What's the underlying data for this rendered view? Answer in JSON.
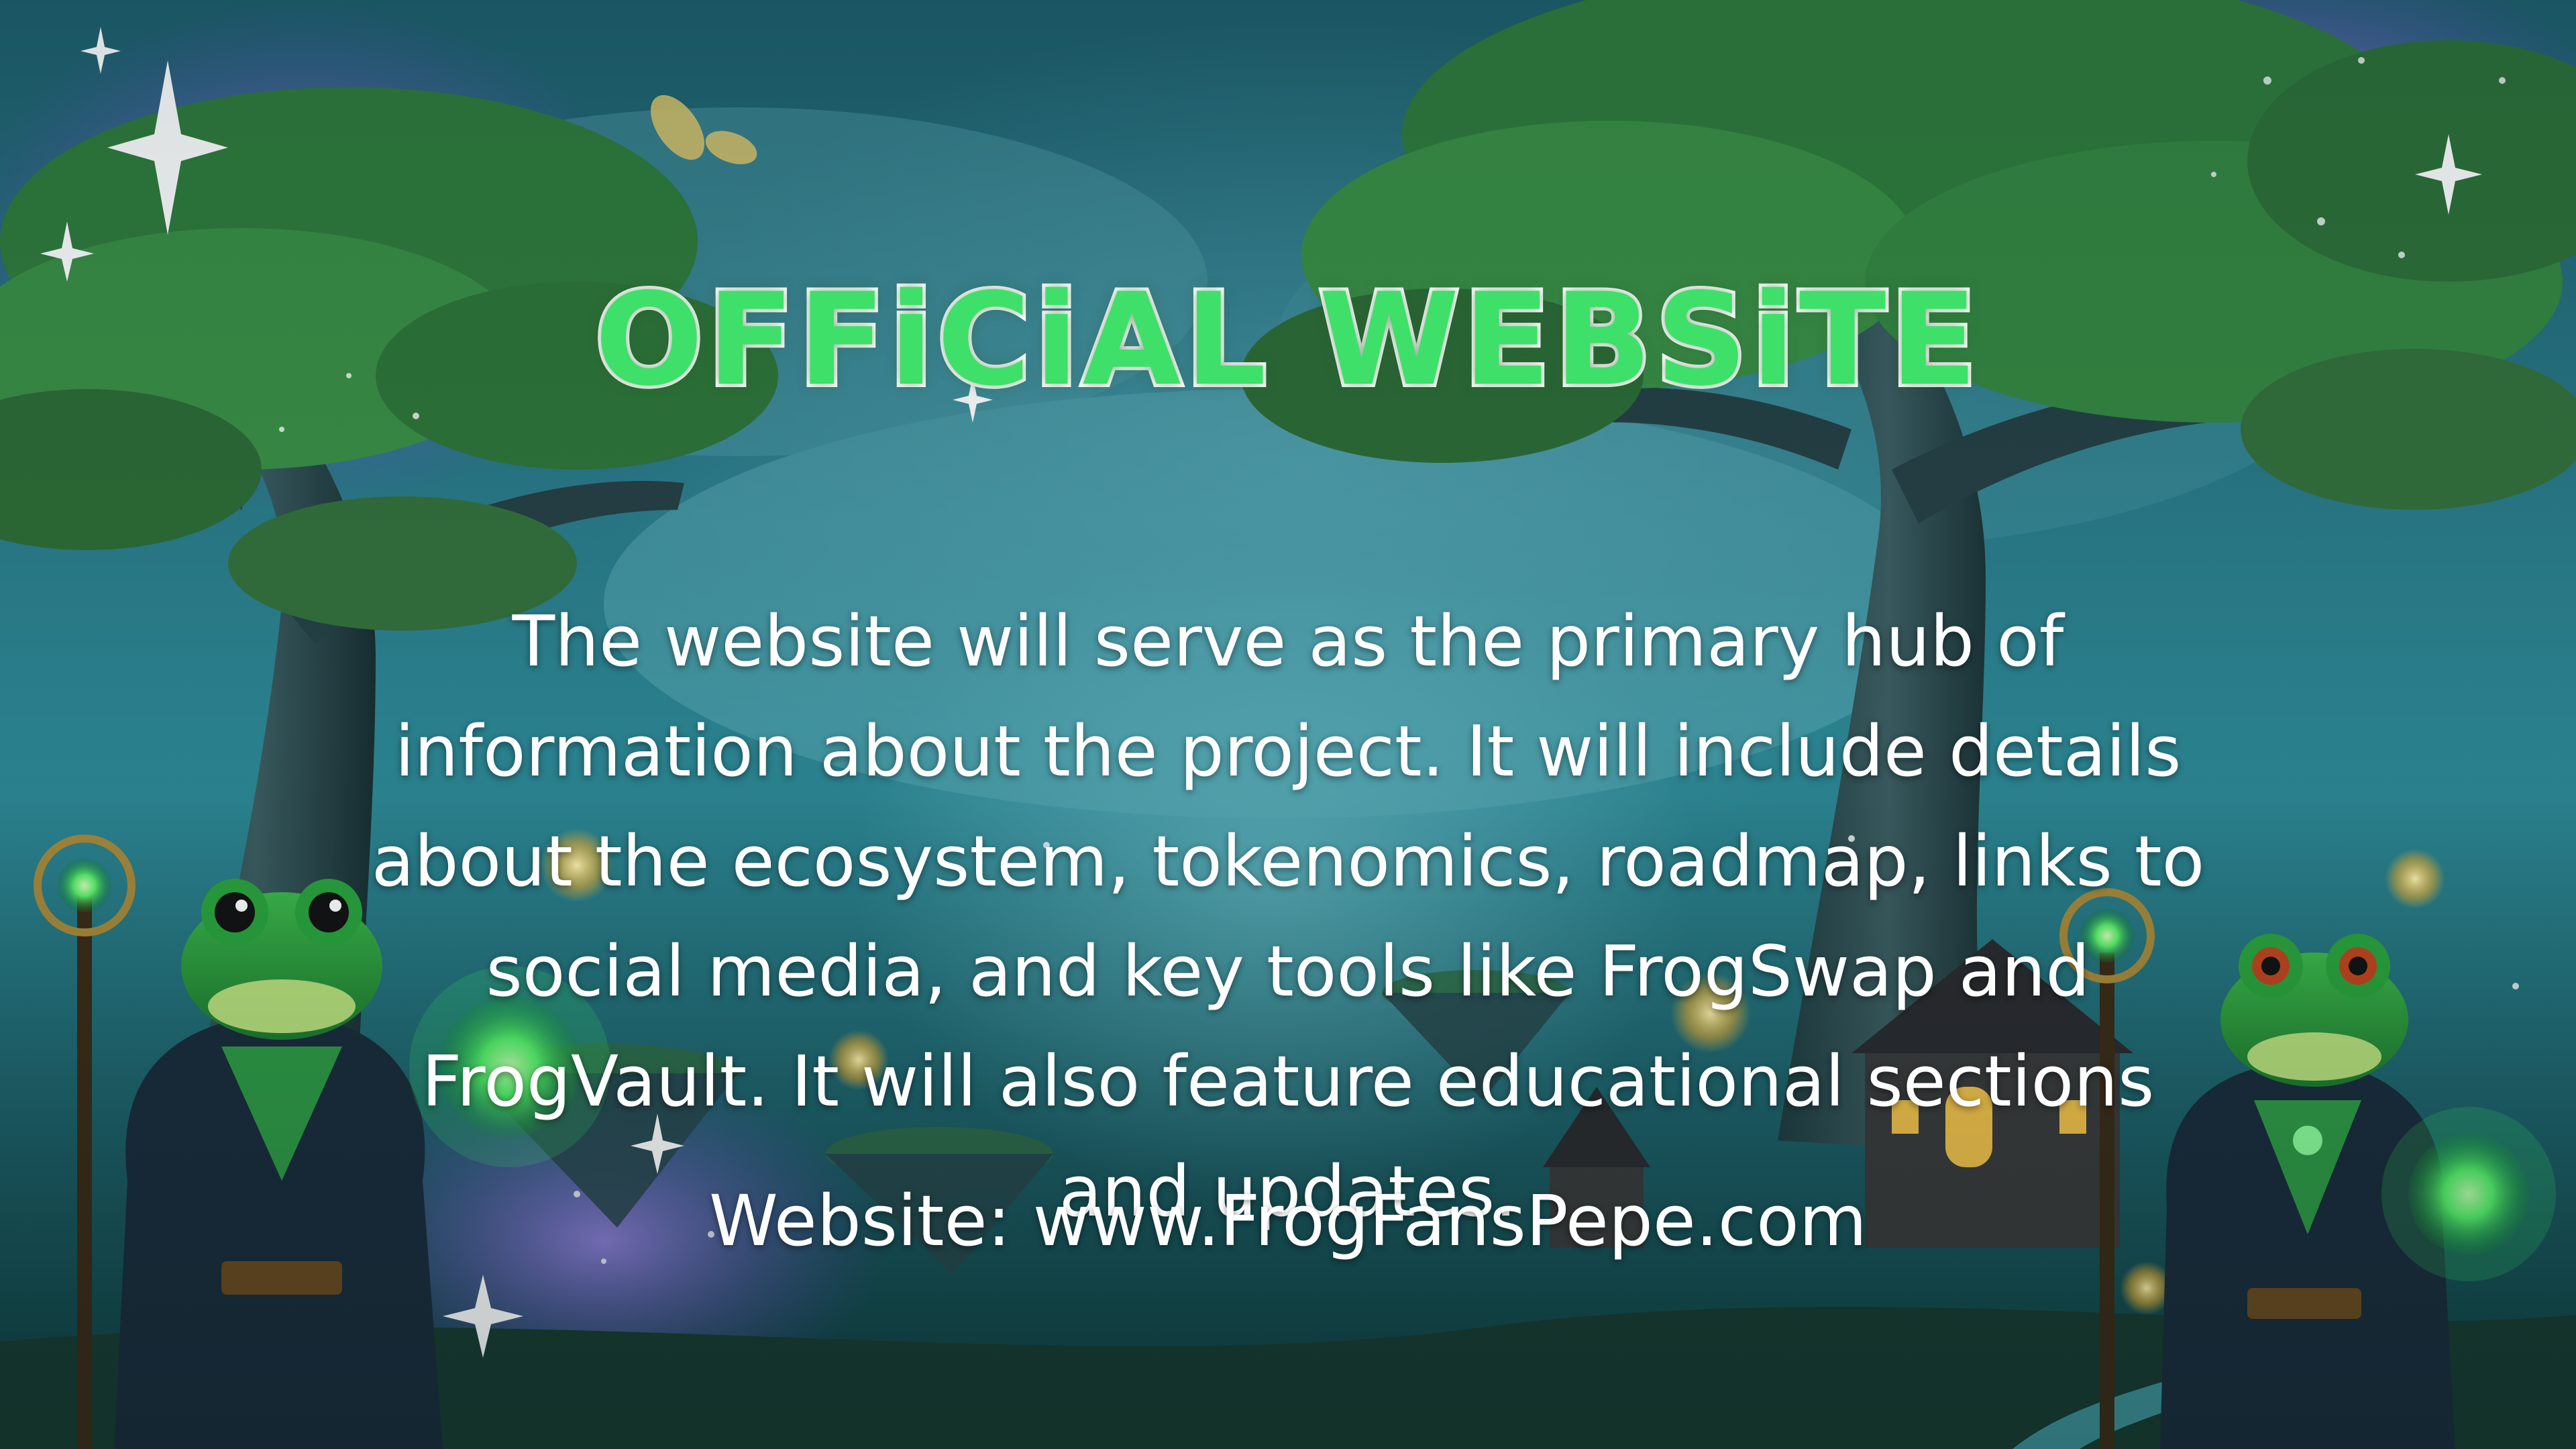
{
  "title": "OFFiCiAL WEBSiTE",
  "description": "The website will serve as the primary hub of information about the project. It will include details about the ecosystem, tokenomics, roadmap, links to social media, and key tools like FrogSwap and FrogVault. It will also feature educational sections and updates.",
  "website": {
    "label": "Website:",
    "url": "www.FrogFansPepe.com"
  },
  "colors": {
    "title_fill": "#3ee06a",
    "title_stroke": "#ffffff",
    "text": "#ffffff",
    "background": "#2a7a88"
  },
  "illustration": {
    "left_character": "frog-wizard-with-staff-and-glowing-orb",
    "right_character": "frog-wizard-with-staff-and-glowing-orb",
    "setting": "enchanted-forest-with-giant-trees-and-floating-islands"
  }
}
